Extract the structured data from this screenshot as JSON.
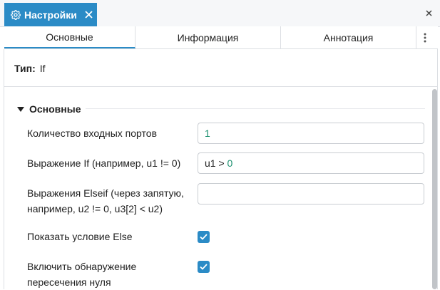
{
  "window": {
    "tab_title": "Настройки",
    "icons": {
      "tab": "gear-icon",
      "tab_close": "close-icon",
      "window_close": "close-icon"
    }
  },
  "tabs": [
    {
      "label": "Основные",
      "selected": true
    },
    {
      "label": "Информация",
      "selected": false
    },
    {
      "label": "Аннотация",
      "selected": false
    }
  ],
  "type_row": {
    "label": "Тип:",
    "value": "If"
  },
  "section": {
    "title": "Основные",
    "expanded": true
  },
  "fields": {
    "input_ports": {
      "label": "Количество входных портов",
      "value": "1"
    },
    "if_expr": {
      "label": "Выражение If (например, u1 != 0)",
      "value_var": "u1",
      "value_op": " > ",
      "value_num": "0"
    },
    "elseif_expr": {
      "label_line1": "Выражения Elseif (через запятую,",
      "label_line2": "например, u2 != 0, u3[2] < u2)",
      "value": ""
    },
    "show_else": {
      "label": "Показать условие Else",
      "checked": true
    },
    "zero_cross": {
      "label_line1": "Включить обнаружение",
      "label_line2": "пересечения нуля",
      "checked": true
    }
  },
  "colors": {
    "accent": "#2b8bc6",
    "number": "#1a8f6e",
    "border": "#dcdfe3"
  }
}
